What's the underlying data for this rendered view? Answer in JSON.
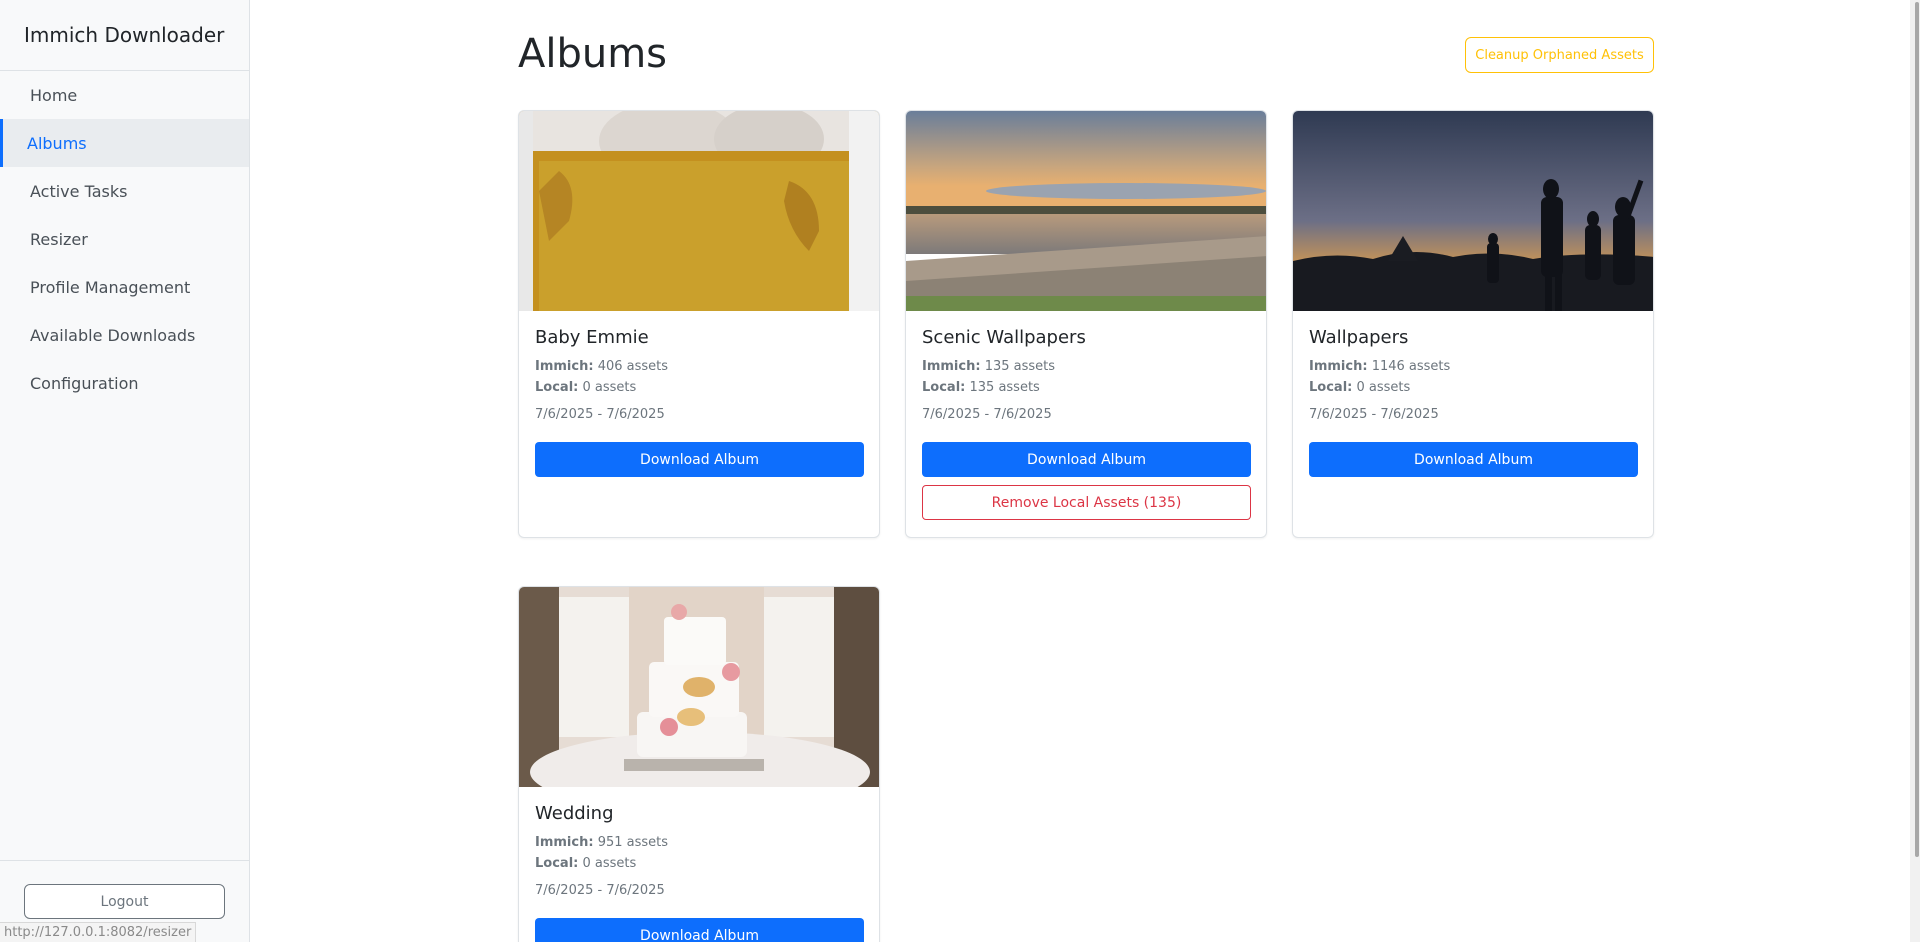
{
  "app": {
    "title": "Immich Downloader"
  },
  "sidebar": {
    "items": [
      {
        "label": "Home",
        "active": false
      },
      {
        "label": "Albums",
        "active": true
      },
      {
        "label": "Active Tasks",
        "active": false
      },
      {
        "label": "Resizer",
        "active": false
      },
      {
        "label": "Profile Management",
        "active": false
      },
      {
        "label": "Available Downloads",
        "active": false
      },
      {
        "label": "Configuration",
        "active": false
      }
    ],
    "logout_label": "Logout"
  },
  "page": {
    "title": "Albums",
    "cleanup_label": "Cleanup Orphaned Assets"
  },
  "albums": [
    {
      "name": "Baby Emmie",
      "immich_label": "Immich:",
      "immich_value": "406 assets",
      "local_label": "Local:",
      "local_value": "0 assets",
      "dates": "7/6/2025 - 7/6/2025",
      "download_label": "Download Album",
      "thumbnail": "baby-in-mustard-knit-blanket"
    },
    {
      "name": "Scenic Wallpapers",
      "immich_label": "Immich:",
      "immich_value": "135 assets",
      "local_label": "Local:",
      "local_value": "135 assets",
      "dates": "7/6/2025 - 7/6/2025",
      "download_label": "Download Album",
      "remove_label": "Remove Local Assets (135)",
      "thumbnail": "lake-sunset"
    },
    {
      "name": "Wallpapers",
      "immich_label": "Immich:",
      "immich_value": "1146 assets",
      "local_label": "Local:",
      "local_value": "0 assets",
      "dates": "7/6/2025 - 7/6/2025",
      "download_label": "Download Album",
      "thumbnail": "festival-crowd-silhouette-sunset"
    },
    {
      "name": "Wedding",
      "immich_label": "Immich:",
      "immich_value": "951 assets",
      "local_label": "Local:",
      "local_value": "0 assets",
      "dates": "7/6/2025 - 7/6/2025",
      "download_label": "Download Album",
      "thumbnail": "wedding-cake"
    }
  ],
  "statusbar": {
    "url": "http://127.0.0.1:8082/resizer"
  },
  "colors": {
    "primary": "#0d6efd",
    "warning": "#ffc107",
    "danger": "#dc3545",
    "sidebar_bg": "#f8f9fa"
  }
}
